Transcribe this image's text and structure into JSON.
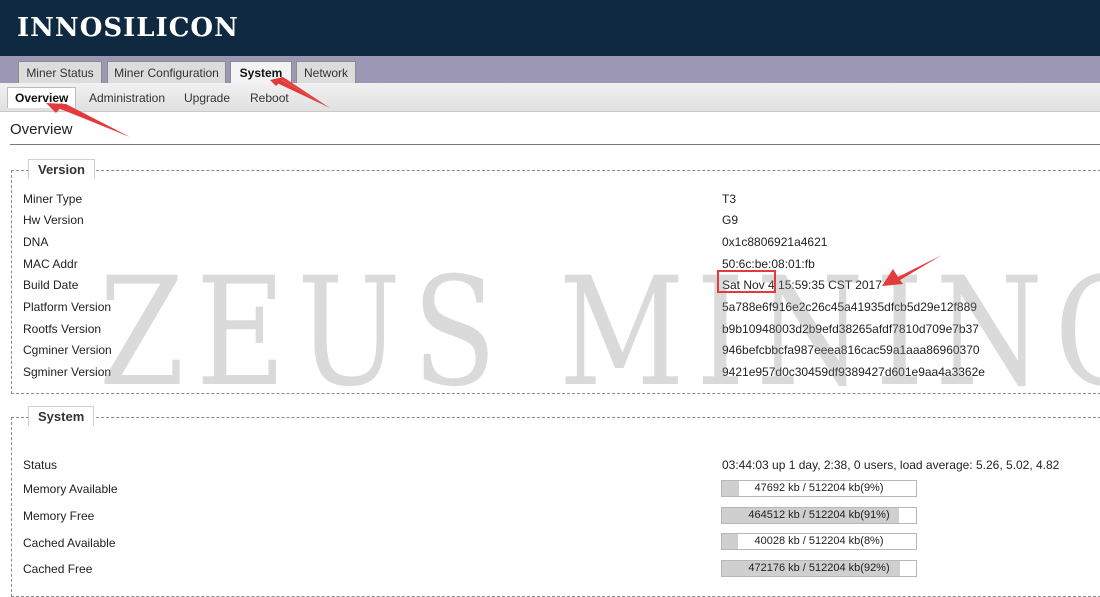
{
  "header": {
    "logo": "INNOSILICON"
  },
  "tabs": [
    {
      "label": "Miner Status",
      "active": false
    },
    {
      "label": "Miner Configuration",
      "active": false
    },
    {
      "label": "System",
      "active": true
    },
    {
      "label": "Network",
      "active": false
    }
  ],
  "subtabs": [
    {
      "label": "Overview",
      "active": true
    },
    {
      "label": "Administration",
      "active": false
    },
    {
      "label": "Upgrade",
      "active": false
    },
    {
      "label": "Reboot",
      "active": false
    }
  ],
  "page_title": "Overview",
  "version": {
    "legend": "Version",
    "rows": [
      {
        "label": "Miner Type",
        "value": "T3"
      },
      {
        "label": "Hw Version",
        "value": "G9"
      },
      {
        "label": "DNA",
        "value": "0x1c8806921a4621"
      },
      {
        "label": "MAC Addr",
        "value": "50:6c:be:08:01:fb"
      },
      {
        "label": "Build Date",
        "value": "Sat Nov 4 15:59:35 CST 2017"
      },
      {
        "label": "Platform Version",
        "value": "5a788e6f916e2c26c45a41935dfcb5d29e12f889"
      },
      {
        "label": "Rootfs Version",
        "value": "b9b10948003d2b9efd38265afdf7810d709e7b37"
      },
      {
        "label": "Cgminer Version",
        "value": "946befcbbcfa987eeea816cac59a1aaa86960370"
      },
      {
        "label": "Sgminer Version",
        "value": "9421e957d0c30459df9389427d601e9aa4a3362e"
      }
    ]
  },
  "system": {
    "legend": "System",
    "status_label": "Status",
    "status_value": "03:44:03 up 1 day, 2:38, 0 users, load average: 5.26, 5.02, 4.82",
    "bars": [
      {
        "label": "Memory Available",
        "text": "47692 kb / 512204 kb(9%)",
        "percent": 9
      },
      {
        "label": "Memory Free",
        "text": "464512 kb / 512204 kb(91%)",
        "percent": 91
      },
      {
        "label": "Cached Available",
        "text": "40028 kb / 512204 kb(8%)",
        "percent": 8
      },
      {
        "label": "Cached Free",
        "text": "472176 kb / 512204 kb(92%)",
        "percent": 92
      }
    ]
  },
  "watermark": "ZEUS MINING",
  "colors": {
    "header_bg": "#0f2a40",
    "tabbar_bg": "#9b97b5",
    "annotation": "#e23b3b",
    "bar_fill": "#cfcfcf"
  }
}
